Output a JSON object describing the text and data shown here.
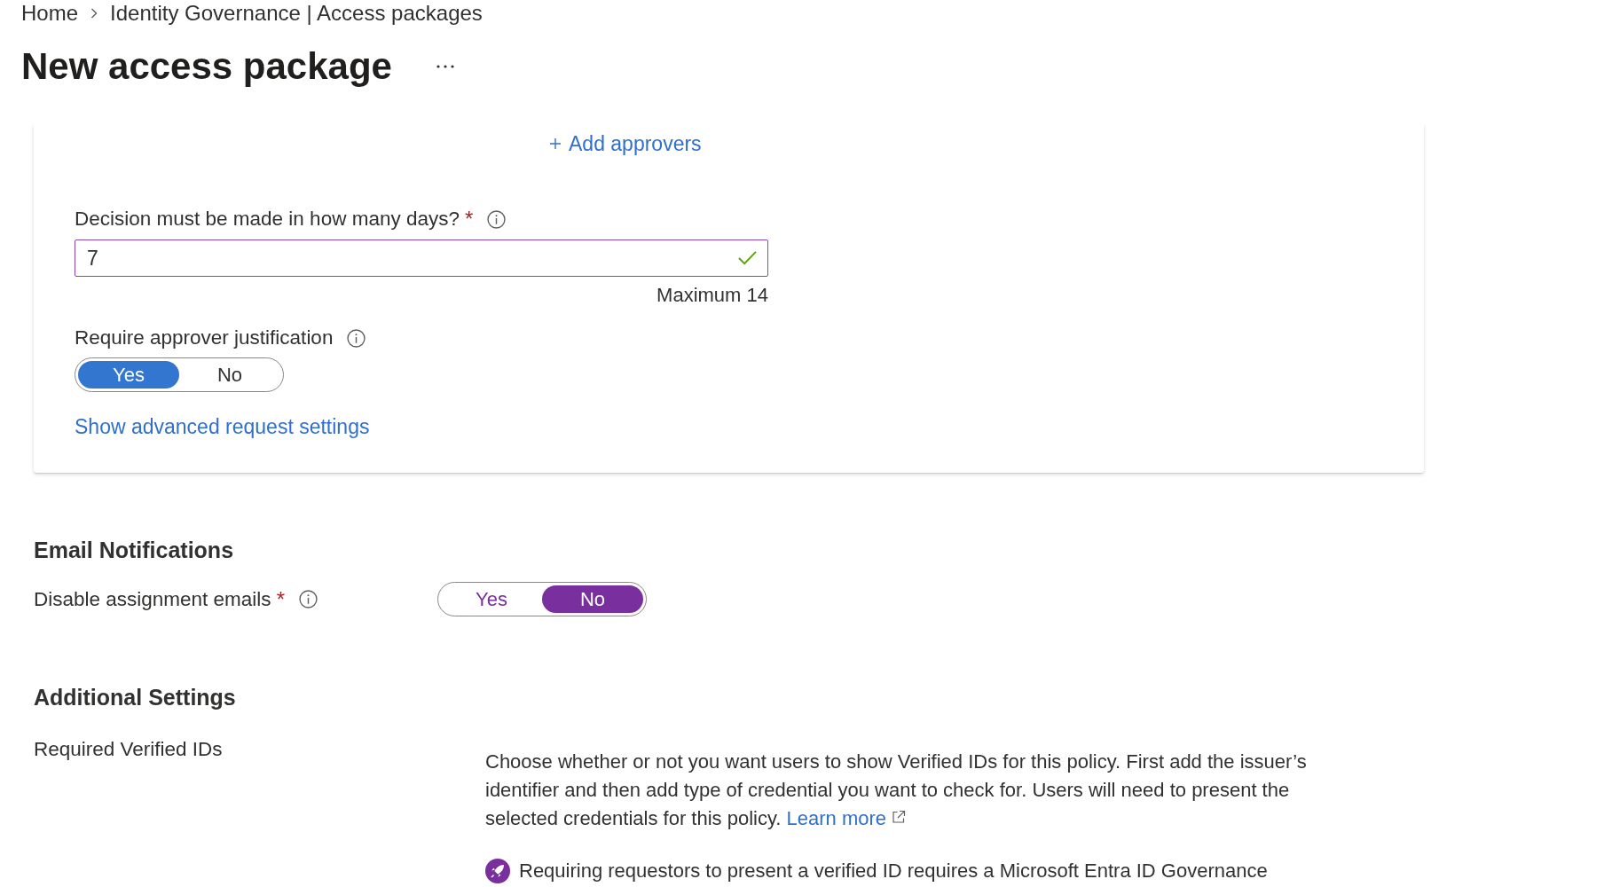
{
  "breadcrumb": [
    {
      "label": "Home"
    },
    {
      "label": "Identity Governance | Access packages"
    }
  ],
  "page_title": "New access package",
  "approval": {
    "add_approvers": "Add approvers",
    "decision_days": {
      "label": "Decision must be made in how many days?",
      "required_mark": "*",
      "value": "7",
      "modified": true,
      "valid": true,
      "hint": "Maximum 14"
    },
    "justification": {
      "label": "Require approver justification",
      "modified": false,
      "options": [
        {
          "label": "Yes",
          "selected": true
        },
        {
          "label": "No",
          "selected": false
        }
      ]
    },
    "advanced_link": "Show advanced request settings"
  },
  "email_notifications": {
    "title": "Email Notifications",
    "disable_assignment_emails": {
      "label": "Disable assignment emails",
      "required_mark": "*",
      "modified": true,
      "options": [
        {
          "label": "Yes",
          "selected": false
        },
        {
          "label": "No",
          "selected": true
        }
      ]
    }
  },
  "additional_settings": {
    "title": "Additional Settings",
    "verified_ids": {
      "label": "Required Verified IDs",
      "description": "Choose whether or not you want users to show Verified IDs for this policy. First add the issuer’s identifier and then add type of credential you want to check for. Users will need to present the selected credentials for this policy.",
      "learn_more": "Learn more",
      "notice": "Requiring requestors to present a verified ID requires a Microsoft Entra ID Governance"
    }
  }
}
